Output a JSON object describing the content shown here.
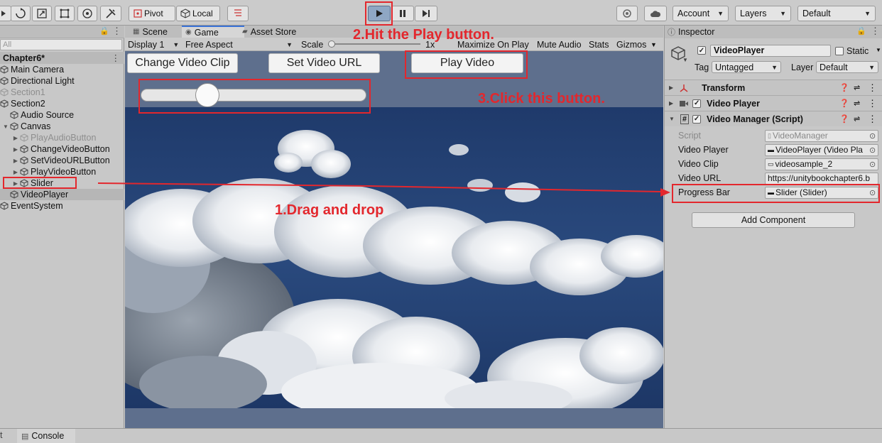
{
  "toolbar": {
    "tool_icons": [
      "play-icon",
      "rotate-icon",
      "scale-icon",
      "rect-icon",
      "transform-icon",
      "custom-tool-icon"
    ],
    "pivot_label": "Pivot",
    "local_label": "Local",
    "snap_icon": "snap-icon",
    "play_icon": "play-icon",
    "pause_icon": "pause-icon",
    "step_icon": "step-icon",
    "account_label": "Account",
    "layers_label": "Layers",
    "layout_label": "Default"
  },
  "hierarchy": {
    "search_placeholder": "All",
    "scene_name": "Chapter6*",
    "items": [
      {
        "label": "Main Camera"
      },
      {
        "label": "Directional Light"
      },
      {
        "label": "Section1"
      },
      {
        "label": "Section2"
      },
      {
        "label": "Audio Source"
      },
      {
        "label": "Canvas"
      },
      {
        "label": "PlayAudioButton"
      },
      {
        "label": "ChangeVideoButton"
      },
      {
        "label": "SetVideoURLButton"
      },
      {
        "label": "PlayVideoButton"
      },
      {
        "label": "Slider"
      },
      {
        "label": "VideoPlayer"
      },
      {
        "label": "EventSystem"
      }
    ]
  },
  "center": {
    "tabs": [
      {
        "label": "Scene"
      },
      {
        "label": "Game"
      },
      {
        "label": "Asset Store"
      }
    ],
    "gamebar": {
      "display": "Display 1",
      "aspect": "Free Aspect",
      "scale_label": "Scale",
      "scale_value": "1x",
      "maximize": "Maximize On Play",
      "mute": "Mute Audio",
      "stats": "Stats",
      "gizmos": "Gizmos"
    },
    "game": {
      "buttons": [
        {
          "label": "Change Video Clip"
        },
        {
          "label": "Set Video URL"
        },
        {
          "label": "Play Video"
        }
      ],
      "slider_value": 0.27
    }
  },
  "inspector": {
    "tab_label": "Inspector",
    "object_name": "VideoPlayer",
    "static_label": "Static",
    "tag_label": "Tag",
    "tag_value": "Untagged",
    "layer_label": "Layer",
    "layer_value": "Default",
    "components": [
      {
        "label": "Transform"
      },
      {
        "label": "Video Player"
      },
      {
        "label": "Video Manager (Script)"
      }
    ],
    "fields": [
      {
        "label": "Script",
        "value": "VideoManager"
      },
      {
        "label": "Video Player",
        "value": "VideoPlayer (Video Pla"
      },
      {
        "label": "Video Clip",
        "value": "videosample_2"
      },
      {
        "label": "Video URL",
        "value": "https://unitybookchapter6.b"
      },
      {
        "label": "Progress Bar",
        "value": "Slider (Slider)"
      }
    ],
    "add_component": "Add Component"
  },
  "annotations": {
    "drag": "1.Drag and drop",
    "play": "2.Hit the Play button.",
    "click": "3.Click this button."
  },
  "bottom": {
    "console_label": "Console"
  },
  "colors": {
    "annotation_red": "#e3272d",
    "sky_top": "#1f3a6b",
    "play_active": "#8fa7c4"
  }
}
